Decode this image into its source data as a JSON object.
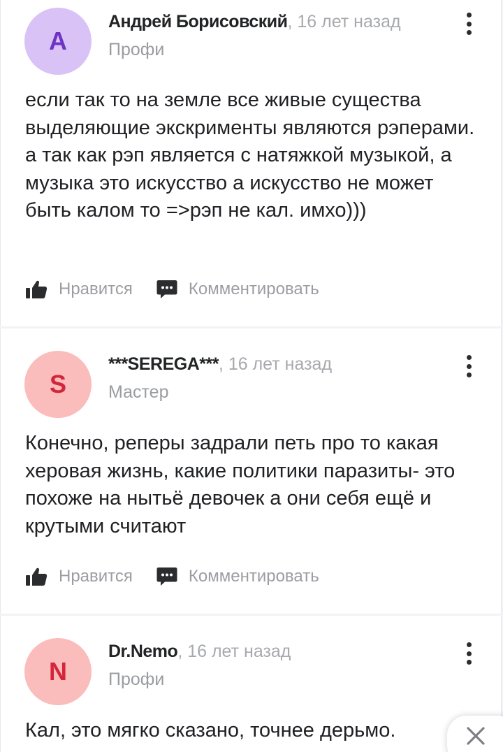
{
  "comments": [
    {
      "avatar_letter": "A",
      "avatar_bg": "#d9c2f5",
      "avatar_fg": "#6f33c4",
      "author": "Андрей Борисовский",
      "time": ", 16 лет назад",
      "rank": "Профи",
      "text": "если так то на земле все живые существа выделяющие экскрименты являются рэперами. а так как рэп является с натяжкой музыкой, а музыка это искусство а искусство не может быть калом то =>рэп не кал. имхо)))",
      "like_label": "Нравится",
      "comment_label": "Комментировать"
    },
    {
      "avatar_letter": "S",
      "avatar_bg": "#fbbcbc",
      "avatar_fg": "#d3263b",
      "author": "***SEREGA***",
      "time": ", 16 лет назад",
      "rank": "Мастер",
      "text": "Конечно, реперы задрали петь про то какая херовая жизнь, какие политики паразиты- это похоже на нытьё девочек а они себя ещё и крутыми считают",
      "like_label": "Нравится",
      "comment_label": "Комментировать"
    },
    {
      "avatar_letter": "N",
      "avatar_bg": "#fbbcbc",
      "avatar_fg": "#d3263b",
      "author": "Dr.Nemo",
      "time": ", 16 лет назад",
      "rank": "Профи",
      "text": "Кал, это мягко сказано, точнее дерьмо."
    }
  ],
  "icons": {
    "like": "thumbs-up-icon",
    "comment": "comment-bubble-icon",
    "menu": "more-vertical-icon",
    "close": "close-icon"
  }
}
